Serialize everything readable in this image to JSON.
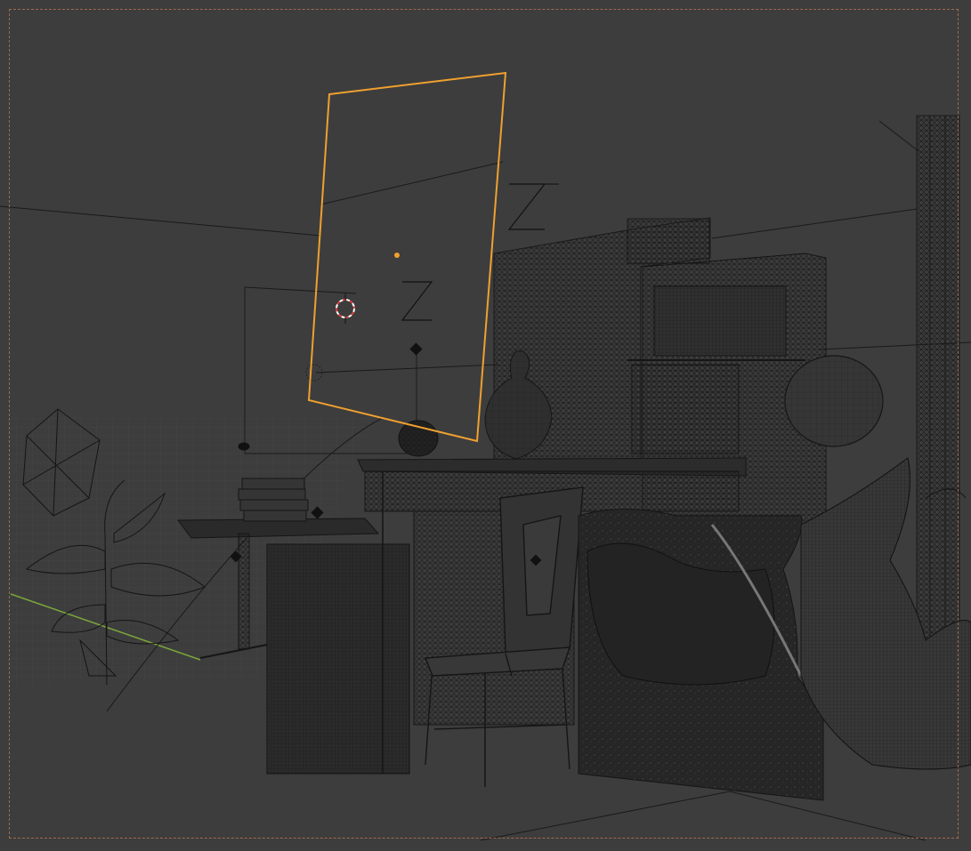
{
  "viewport": {
    "mode": "wireframe",
    "background_color": "#3d3d3d",
    "wire_color": "#111111",
    "selection_color": "#f0a030",
    "x_axis_color": "#7aa53a",
    "cursor_color": "#e04040"
  },
  "objects": [
    {
      "name": "area-light",
      "selected": true
    },
    {
      "name": "plant",
      "selected": false
    },
    {
      "name": "desk",
      "selected": false
    },
    {
      "name": "side-table",
      "selected": false
    },
    {
      "name": "chair",
      "selected": false
    },
    {
      "name": "lion-statue",
      "selected": false
    },
    {
      "name": "vase",
      "selected": false
    },
    {
      "name": "sphere",
      "selected": false
    },
    {
      "name": "column",
      "selected": false
    },
    {
      "name": "cabinet",
      "selected": false
    },
    {
      "name": "book-stack",
      "selected": false
    },
    {
      "name": "radiator",
      "selected": false
    },
    {
      "name": "fabric-drape",
      "selected": false
    }
  ]
}
